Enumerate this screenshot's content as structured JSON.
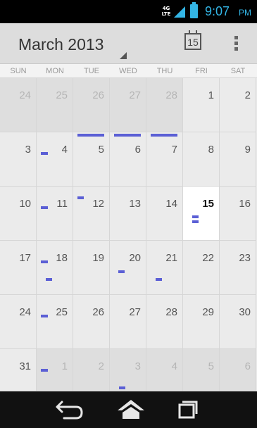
{
  "status_bar": {
    "network_label": "4G LTE",
    "time": "9:07",
    "ampm": "PM",
    "accent_color": "#33b5e5"
  },
  "header": {
    "month_title": "March 2013",
    "today_button_label": "15",
    "overflow_icon": "overflow-menu-icon"
  },
  "weekdays": [
    "SUN",
    "MON",
    "TUE",
    "WED",
    "THU",
    "FRI",
    "SAT"
  ],
  "calendar": {
    "event_color": "#5b5fd5",
    "today": "15",
    "weeks": [
      [
        {
          "day": "24",
          "other_month": true,
          "events": []
        },
        {
          "day": "25",
          "other_month": true,
          "events": []
        },
        {
          "day": "26",
          "other_month": true,
          "events": []
        },
        {
          "day": "27",
          "other_month": true,
          "events": []
        },
        {
          "day": "28",
          "other_month": true,
          "events": []
        },
        {
          "day": "1",
          "other_month": false,
          "events": []
        },
        {
          "day": "2",
          "other_month": false,
          "events": []
        }
      ],
      [
        {
          "day": "3",
          "other_month": false,
          "events": []
        },
        {
          "day": "4",
          "other_month": false,
          "events": [
            "short-left"
          ]
        },
        {
          "day": "5",
          "other_month": false,
          "events": [
            "all-day"
          ]
        },
        {
          "day": "6",
          "other_month": false,
          "events": [
            "all-day"
          ]
        },
        {
          "day": "7",
          "other_month": false,
          "events": [
            "all-day"
          ]
        },
        {
          "day": "8",
          "other_month": false,
          "events": []
        },
        {
          "day": "9",
          "other_month": false,
          "events": []
        }
      ],
      [
        {
          "day": "10",
          "other_month": false,
          "events": []
        },
        {
          "day": "11",
          "other_month": false,
          "events": [
            "short-left"
          ]
        },
        {
          "day": "12",
          "other_month": false,
          "events": [
            "short-top"
          ]
        },
        {
          "day": "13",
          "other_month": false,
          "events": []
        },
        {
          "day": "14",
          "other_month": false,
          "events": []
        },
        {
          "day": "15",
          "other_month": false,
          "events": [
            "double"
          ]
        },
        {
          "day": "16",
          "other_month": false,
          "events": []
        }
      ],
      [
        {
          "day": "17",
          "other_month": false,
          "events": []
        },
        {
          "day": "18",
          "other_month": false,
          "events": [
            "short-left",
            "short-low"
          ]
        },
        {
          "day": "19",
          "other_month": false,
          "events": []
        },
        {
          "day": "20",
          "other_month": false,
          "events": [
            "short-mid"
          ]
        },
        {
          "day": "21",
          "other_month": false,
          "events": [
            "short-low"
          ]
        },
        {
          "day": "22",
          "other_month": false,
          "events": []
        },
        {
          "day": "23",
          "other_month": false,
          "events": []
        }
      ],
      [
        {
          "day": "24",
          "other_month": false,
          "events": []
        },
        {
          "day": "25",
          "other_month": false,
          "events": [
            "short-left"
          ]
        },
        {
          "day": "26",
          "other_month": false,
          "events": []
        },
        {
          "day": "27",
          "other_month": false,
          "events": []
        },
        {
          "day": "28",
          "other_month": false,
          "events": []
        },
        {
          "day": "29",
          "other_month": false,
          "events": []
        },
        {
          "day": "30",
          "other_month": false,
          "events": []
        }
      ],
      [
        {
          "day": "31",
          "other_month": false,
          "events": []
        },
        {
          "day": "1",
          "other_month": true,
          "events": [
            "short-left"
          ]
        },
        {
          "day": "2",
          "other_month": true,
          "events": []
        },
        {
          "day": "3",
          "other_month": true,
          "events": [
            "short-low"
          ]
        },
        {
          "day": "4",
          "other_month": true,
          "events": []
        },
        {
          "day": "5",
          "other_month": true,
          "events": []
        },
        {
          "day": "6",
          "other_month": true,
          "events": []
        }
      ]
    ]
  },
  "nav_bar": {
    "back_icon": "back-icon",
    "home_icon": "home-icon",
    "recent_icon": "recent-apps-icon"
  }
}
